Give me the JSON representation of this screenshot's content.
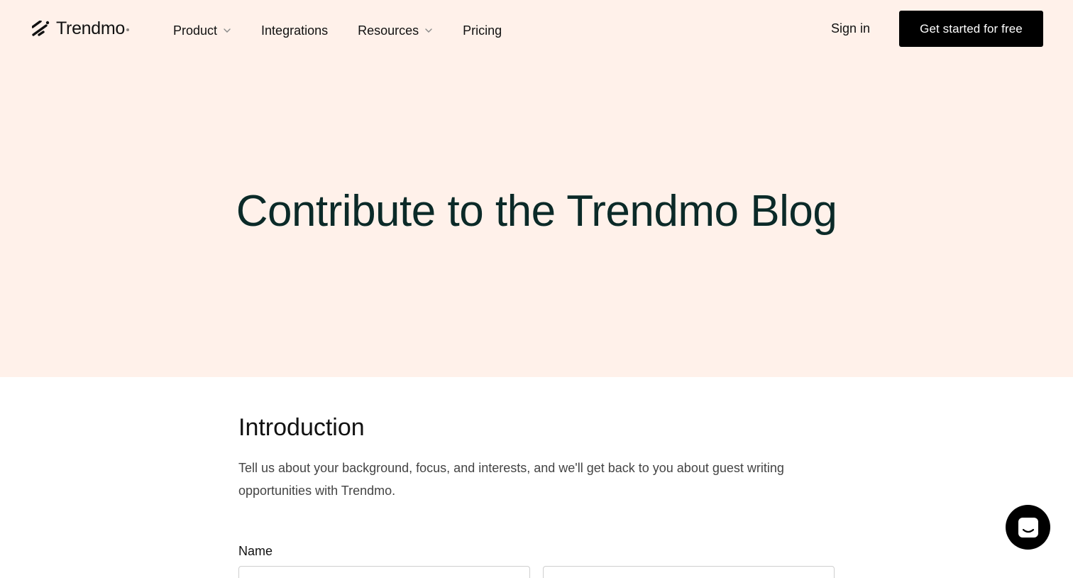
{
  "brand": {
    "name": "Trendmo"
  },
  "nav": {
    "items": [
      {
        "label": "Product",
        "has_dropdown": true
      },
      {
        "label": "Integrations",
        "has_dropdown": false
      },
      {
        "label": "Resources",
        "has_dropdown": true
      },
      {
        "label": "Pricing",
        "has_dropdown": false
      }
    ],
    "signin_label": "Sign in",
    "cta_label": "Get started for free"
  },
  "hero": {
    "title": "Contribute to the Trendmo Blog"
  },
  "form": {
    "section_title": "Introduction",
    "section_desc": "Tell us about your background, focus, and interests, and we'll get back to you about guest writing opportunities with Trendmo.",
    "name_label": "Name",
    "first_name_value": "",
    "last_name_value": ""
  },
  "colors": {
    "hero_bg": "#fff1ea",
    "title_color": "#0b2a28",
    "cta_bg": "#000000"
  },
  "icons": {
    "logo": "trendmo-slash-icon",
    "dropdown": "chevron-down-icon",
    "chat": "chat-icon"
  }
}
